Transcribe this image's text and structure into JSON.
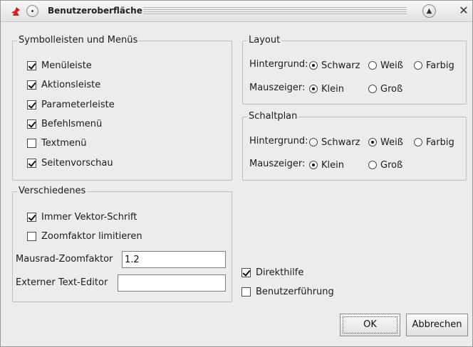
{
  "window": {
    "title": "Benutzeroberfläche",
    "icons": {
      "app": "app-logo-icon",
      "menu": "window-menu-icon",
      "shade": "shade-icon",
      "close": "close-icon"
    },
    "close_glyph": "✕",
    "shade_glyph": "▲"
  },
  "toolbars": {
    "legend": "Symbolleisten und Menüs",
    "items": [
      {
        "label": "Menüleiste",
        "checked": true
      },
      {
        "label": "Aktionsleiste",
        "checked": true
      },
      {
        "label": "Parameterleiste",
        "checked": true
      },
      {
        "label": "Befehlsmenü",
        "checked": true
      },
      {
        "label": "Textmenü",
        "checked": false
      },
      {
        "label": "Seitenvorschau",
        "checked": true
      }
    ]
  },
  "misc": {
    "legend": "Verschiedenes",
    "vector_font": {
      "label": "Immer Vektor-Schrift",
      "checked": true
    },
    "limit_zoom": {
      "label": "Zoomfaktor limitieren",
      "checked": false
    },
    "wheel_zoom": {
      "label": "Mausrad-Zoomfaktor",
      "value": "1.2"
    },
    "text_editor": {
      "label": "Externer Text-Editor",
      "value": ""
    }
  },
  "layout": {
    "legend": "Layout",
    "background": {
      "label": "Hintergrund:",
      "options": [
        "Schwarz",
        "Weiß",
        "Farbig"
      ],
      "selected": "Schwarz"
    },
    "cursor": {
      "label": "Mauszeiger:",
      "options": [
        "Klein",
        "Groß"
      ],
      "selected": "Klein"
    }
  },
  "schematic": {
    "legend": "Schaltplan",
    "background": {
      "label": "Hintergrund:",
      "options": [
        "Schwarz",
        "Weiß",
        "Farbig"
      ],
      "selected": "Weiß"
    },
    "cursor": {
      "label": "Mauszeiger:",
      "options": [
        "Klein",
        "Groß"
      ],
      "selected": "Klein"
    }
  },
  "help": {
    "direct_help": {
      "label": "Direkthilfe",
      "checked": true
    },
    "guidance": {
      "label": "Benutzerführung",
      "checked": false
    }
  },
  "buttons": {
    "ok": "OK",
    "cancel": "Abbrechen"
  },
  "colors": {
    "window_bg": "#ececec",
    "border": "#bdbdbd",
    "icon_red": "#d42020"
  }
}
